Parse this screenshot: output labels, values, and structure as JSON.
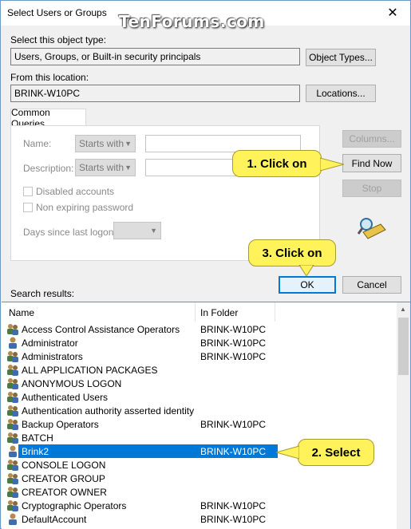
{
  "window": {
    "title": "Select Users or Groups",
    "close_glyph": "✕",
    "watermark": "TenForums.com"
  },
  "object_type": {
    "label": "Select this object type:",
    "value": "Users, Groups, or Built-in security principals",
    "button": "Object Types..."
  },
  "location": {
    "label": "From this location:",
    "value": "BRINK-W10PC",
    "button": "Locations..."
  },
  "queries": {
    "tab": "Common Queries",
    "name_label": "Name:",
    "description_label": "Description:",
    "starts_with": "Starts with",
    "disabled_accounts": "Disabled accounts",
    "non_expiring": "Non expiring password",
    "days_since_logon": "Days since last logon:"
  },
  "buttons": {
    "columns": "Columns...",
    "find_now": "Find Now",
    "stop": "Stop",
    "ok": "OK",
    "cancel": "Cancel"
  },
  "callouts": {
    "c1": "1. Click on",
    "c2": "2. Select",
    "c3": "3. Click on"
  },
  "results": {
    "label": "Search results:",
    "columns": [
      "Name",
      "In Folder"
    ],
    "rows": [
      {
        "name": "Access Control Assistance Operators",
        "folder": "BRINK-W10PC",
        "icon": "group-icon"
      },
      {
        "name": "Administrator",
        "folder": "BRINK-W10PC",
        "icon": "user-icon"
      },
      {
        "name": "Administrators",
        "folder": "BRINK-W10PC",
        "icon": "group-icon"
      },
      {
        "name": "ALL APPLICATION PACKAGES",
        "folder": "",
        "icon": "group-icon"
      },
      {
        "name": "ANONYMOUS LOGON",
        "folder": "",
        "icon": "group-icon"
      },
      {
        "name": "Authenticated Users",
        "folder": "",
        "icon": "group-icon"
      },
      {
        "name": "Authentication authority asserted identity",
        "folder": "",
        "icon": "group-icon"
      },
      {
        "name": "Backup Operators",
        "folder": "BRINK-W10PC",
        "icon": "group-icon"
      },
      {
        "name": "BATCH",
        "folder": "",
        "icon": "group-icon"
      },
      {
        "name": "Brink2",
        "folder": "BRINK-W10PC",
        "icon": "user-icon",
        "selected": true
      },
      {
        "name": "CONSOLE LOGON",
        "folder": "",
        "icon": "group-icon"
      },
      {
        "name": "CREATOR GROUP",
        "folder": "",
        "icon": "group-icon"
      },
      {
        "name": "CREATOR OWNER",
        "folder": "",
        "icon": "group-icon"
      },
      {
        "name": "Cryptographic Operators",
        "folder": "BRINK-W10PC",
        "icon": "group-icon"
      },
      {
        "name": "DefaultAccount",
        "folder": "BRINK-W10PC",
        "icon": "user-icon"
      }
    ]
  },
  "colors": {
    "selection": "#0078d7",
    "callout": "#fff25a",
    "accent": "#0078d7"
  }
}
